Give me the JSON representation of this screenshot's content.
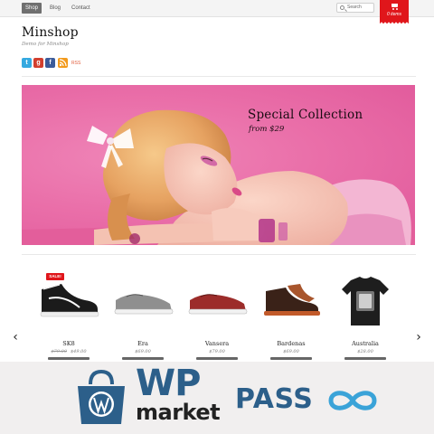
{
  "topbar": {
    "nav": [
      "Shop",
      "Blog",
      "Contact"
    ],
    "search_placeholder": "Search",
    "cart_label": "0 items"
  },
  "header": {
    "title": "Minshop",
    "tagline": "Demo for Minshop",
    "social_icons": [
      "twitter-icon",
      "google-plus-icon",
      "facebook-icon",
      "rss-icon"
    ],
    "rss_label": "RSS"
  },
  "banner": {
    "title": "Special Collection",
    "subtitle": "from $29"
  },
  "products": [
    {
      "name": "SK8",
      "old_price": "$79.00",
      "price": "$49.00",
      "sale": "SALE!"
    },
    {
      "name": "Era",
      "price": "$69.00"
    },
    {
      "name": "Vansera",
      "price": "$79.00"
    },
    {
      "name": "Bardenas",
      "price": "$69.00"
    },
    {
      "name": "Australia",
      "price": "$28.00"
    }
  ],
  "promo": {
    "brand_big": "WP",
    "brand_small": "market",
    "pass_word": "PASS"
  },
  "colors": {
    "accent_red": "#e0161b",
    "banner_pink": "#ea6fa9",
    "promo_blue": "#2c5f8a"
  }
}
